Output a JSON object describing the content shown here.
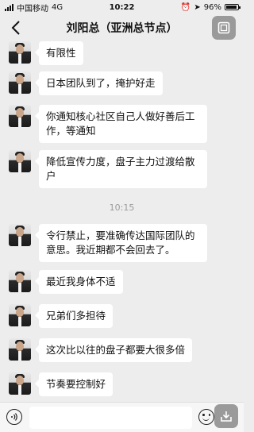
{
  "status_bar": {
    "carrier": "中国移动",
    "network": "4G",
    "time": "10:22",
    "battery": "96%",
    "battery_level": 0.96
  },
  "header": {
    "title": "刘阳总（亚洲总节点）"
  },
  "messages": [
    {
      "text": "有限性"
    },
    {
      "text": "日本团队到了，掩护好走"
    },
    {
      "text": "你通知核心社区自己人做好善后工作，等通知"
    },
    {
      "text": "降低宣传力度，盘子主力过渡给散户"
    },
    {
      "text": "令行禁止，要准确传达国际团队的意思。我近期都不会回去了。"
    },
    {
      "text": "最近我身体不适"
    },
    {
      "text": "兄弟们多担待"
    },
    {
      "text": "这次比以往的盘子都要大很多倍"
    },
    {
      "text": "节奏要控制好"
    }
  ],
  "timestamp": "10:15",
  "input": {
    "value": "",
    "placeholder": ""
  },
  "icons": {
    "back": "back-arrow-icon",
    "more": "more-icon",
    "voice": "voice-icon",
    "emoji": "emoji-icon",
    "download": "download-icon"
  }
}
